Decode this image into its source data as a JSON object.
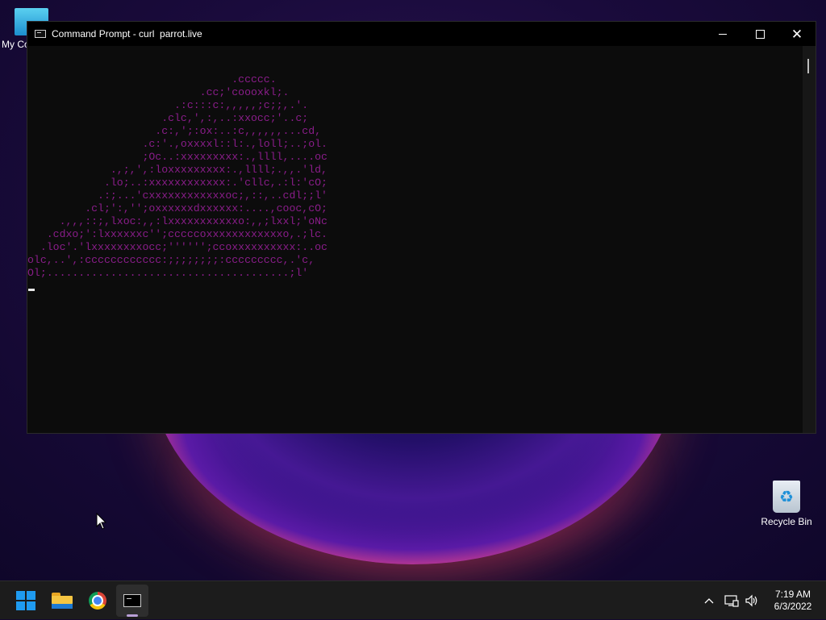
{
  "desktop": {
    "icons": {
      "my_computer_label": "My Co",
      "recycle_bin_label": "Recycle Bin"
    },
    "colors": {
      "background": "#1a0b3c",
      "orb_rim": "#ff6a7a",
      "orb_core": "#2a0f7c"
    }
  },
  "window": {
    "title": "Command Prompt - curl  parrot.live",
    "icon": "cmd-icon",
    "buttons": {
      "minimize": "minimize-icon",
      "maximize": "maximize-icon",
      "close": "close-icon"
    }
  },
  "console": {
    "color": "#8a1d8a",
    "ascii_art": "                                .ccccc.\n                           .cc;'coooxkl;.\n                       .:c:::c:,,,,,;c;;,.'.\n                     .clc,',:,..:xxocc;'..c;\n                    .c:,';:ox:..:c,,,,,,...cd,\n                  .c:'.,oxxxxl::l:.,loll;..;ol.\n                  ;Oc..:xxxxxxxxx:.,llll,....oc\n             .,;,',:loxxxxxxxxx:.,llll;.,,.'ld,\n            .lo;..:xxxxxxxxxxxx:.'cllc,.:l:'cO;\n           .:;...'cxxxxxxxxxxxxoc;,::,..cdl;;l'\n         .cl;':,'';oxxxxxxdxxxxxx:....,cooc,cO;\n     .,,,::;,lxoc:,,:lxxxxxxxxxxxo:,,;lxxl;'oNc\n   .cdxo;':lxxxxxxc'';cccccoxxxxxxxxxxxxo,.;lc.\n  .loc'.'lxxxxxxxxocc;'''''';ccoxxxxxxxxxx:..oc\nolc,..',:cccccccccccc:;;;;;;;;:ccccccccc,.'c,\nOl;......................................;l'"
  },
  "taskbar": {
    "apps": {
      "start": "start-icon",
      "file_explorer": "folder-icon",
      "chrome": "chrome-icon",
      "command_prompt": "cmd-icon"
    },
    "tray": {
      "chevron": "^",
      "network": "🖧",
      "volume": "🔊"
    },
    "clock": {
      "time": "7:19 AM",
      "date": "6/3/2022"
    }
  }
}
